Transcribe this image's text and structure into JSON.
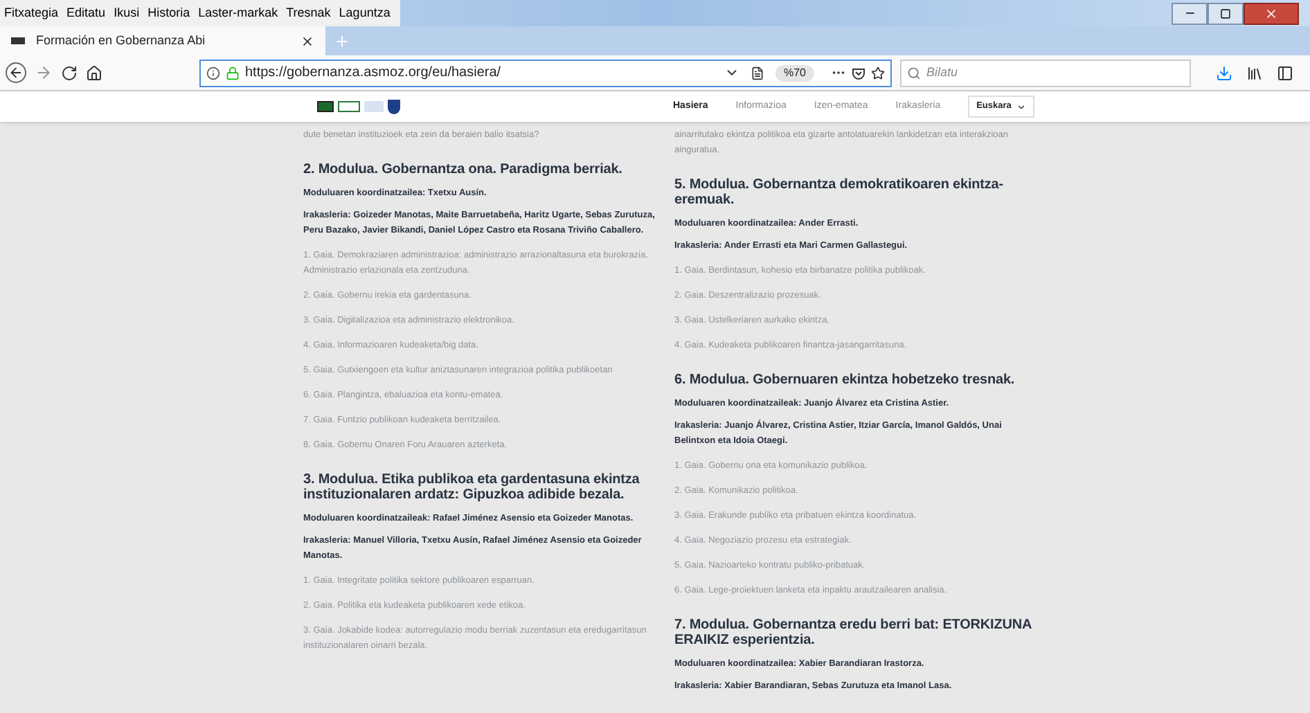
{
  "menu_bar": [
    "Fitxategia",
    "Editatu",
    "Ikusi",
    "Historia",
    "Laster-markak",
    "Tresnak",
    "Laguntza"
  ],
  "tabs": [
    {
      "label": "Formación en Gobernanza Abi",
      "selected": true
    }
  ],
  "address_bar": {
    "url": "https://gobernanza.asmoz.org/eu/hasiera/",
    "zoom": "%70"
  },
  "search": {
    "placeholder": "Bilatu"
  },
  "site_nav": [
    {
      "label": "Hasiera",
      "selected": true
    },
    {
      "label": "Informazioa",
      "selected": false
    },
    {
      "label": "Izen-ematea",
      "selected": false
    },
    {
      "label": "Irakasleria",
      "selected": false
    }
  ],
  "language": "Euskara",
  "columns": [
    [
      {
        "kind": "text",
        "text": "dute benetan instituzioek eta zein da beraien balio itsatsia?"
      },
      {
        "kind": "module",
        "title": "2. Modulua. Gobernantza ona. Paradigma berriak.",
        "coordinator": "Moduluaren koordinatzailea: Txetxu Ausín.",
        "teachers": "Irakasleria: Goizeder Manotas, Maite Barruetabeña, Haritz Ugarte, Sebas Zurutuza, Peru Bazako, Javier Bikandi, Daniel López Castro eta Rosana Triviño Caballero.",
        "topics": [
          "1. Gaia. Demokraziaren administrazioa: administrazio arrazionaltasuna eta burokrazia. Administrazio erlazionala eta zentzuduna.",
          "2. Gaia. Gobernu irekia eta gardentasuna.",
          "3. Gaia. Digitalizazioa eta administrazio elektronikoa.",
          "4. Gaia. Informazioaren kudeaketa/big data.",
          "5. Gaia. Gutxiengoen eta kultur aniztasunaren integrazioa politika publikoetan",
          "6. Gaia. Plangintza, ebaluazioa eta kontu-ematea.",
          "7. Gaia. Funtzio publikoan kudeaketa berritzailea.",
          "8. Gaia. Gobernu Onaren Foru Arauaren azterketa."
        ]
      },
      {
        "kind": "module",
        "title": "3. Modulua. Etika publikoa eta gardentasuna ekintza instituzionalaren ardatz: Gipuzkoa adibide bezala.",
        "coordinator": "Moduluaren koordinatzaileak: Rafael Jiménez Asensio eta Goizeder Manotas.",
        "teachers": "Irakasleria: Manuel Villoria, Txetxu Ausín, Rafael Jiménez Asensio eta Goizeder Manotas.",
        "topics": [
          "1. Gaia. Integritate politika sektore publikoaren esparruan.",
          "2. Gaia. Politika eta kudeaketa publikoaren xede etikoa.",
          "3. Gaia. Jokabide kodea: autorregulazio modu berriak zuzentasun eta eredugarritasun instituzionalaren oinarri bezala."
        ]
      }
    ],
    [
      {
        "kind": "text",
        "text": "ainarritutako ekintza politikoa eta gizarte antolatuarekin lankidetzan eta interakzioan ainguratua."
      },
      {
        "kind": "module",
        "title": "5. Modulua. Gobernantza demokratikoaren ekintza-eremuak.",
        "coordinator": "Moduluaren koordinatzailea: Ander Errasti.",
        "teachers": "Irakasleria: Ander Errasti eta Mari Carmen Gallastegui.",
        "topics": [
          "1. Gaia. Berdintasun, kohesio eta birbanatze politika publikoak.",
          "2. Gaia. Deszentralizazio prozesuak.",
          "3. Gaia. Ustelkeriaren aurkako ekintza.",
          "4. Gaia. Kudeaketa publikoaren finantza-jasangarritasuna."
        ]
      },
      {
        "kind": "module",
        "title": "6. Modulua. Gobernuaren ekintza hobetzeko tresnak.",
        "coordinator": "Moduluaren koordinatzaileak: Juanjo Álvarez eta Cristina Astier.",
        "teachers": "Irakasleria: Juanjo Álvarez, Cristina Astier, Itziar García, Imanol Galdós, Unai Belintxon eta Idoia Otaegi.",
        "topics": [
          "1. Gaia. Gobernu ona eta komunikazio publikoa.",
          "2. Gaia. Komunikazio politikoa.",
          "3. Gaia. Erakunde publiko eta pribatuen ekintza koordinatua.",
          "4. Gaia. Negoziazio prozesu eta estrategiak.",
          "5. Gaia. Nazioarteko kontratu publiko-pribatuak.",
          "6. Gaia. Lege-proiektuen lanketa eta inpaktu arautzailearen analisia."
        ]
      },
      {
        "kind": "module",
        "title": "7. Modulua. Gobernantza eredu berri bat: ETORKIZUNA ERAIKIZ esperientzia.",
        "coordinator": "Moduluaren koordinatzailea: Xabier Barandiaran Irastorza.",
        "teachers": "Irakasleria: Xabier Barandiaran, Sebas Zurutuza eta Imanol Lasa."
      }
    ]
  ]
}
